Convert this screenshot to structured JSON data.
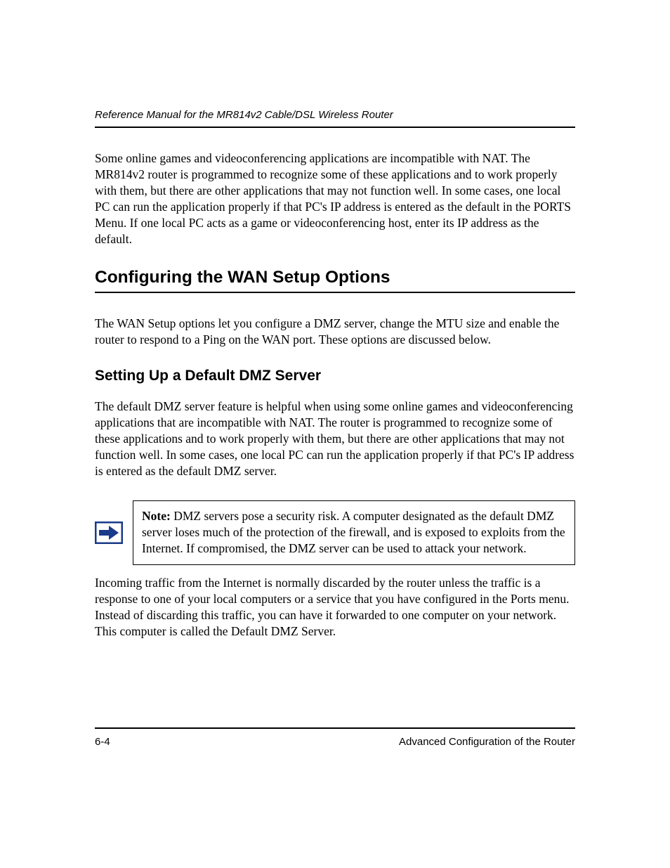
{
  "header": {
    "title": "Reference Manual for the MR814v2 Cable/DSL Wireless Router"
  },
  "content": {
    "para1": "Some online games and videoconferencing applications are incompatible with NAT. The MR814v2 router is programmed to recognize some of these applications and to work properly with them, but there are other applications that may not function well. In some cases, one local PC can run the application properly if that PC's IP address is entered as the default in the PORTS Menu. If one local PC acts as a game or videoconferencing host, enter its IP address as the default.",
    "h1": "Configuring the WAN Setup Options",
    "para2": "The WAN Setup options let you configure a DMZ server, change the MTU size and enable the router to respond to a Ping on the WAN port. These options are discussed below.",
    "h2": "Setting Up a Default DMZ Server",
    "para3": "The default DMZ server feature is helpful when using some online games and videoconferencing applications that are incompatible with NAT. The router is programmed to recognize some of these applications and to work properly with them, but there are other applications that may not function well. In some cases, one local PC can run the application properly if that PC's IP address is entered as the default DMZ server.",
    "note": {
      "label": "Note:",
      "text": " DMZ servers pose a security risk. A computer designated as the default DMZ server loses much of the protection of the firewall, and is exposed to exploits from the Internet. If compromised, the DMZ server can be used to attack your network."
    },
    "para4": "Incoming traffic from the Internet is normally discarded by the router unless the traffic is a response to one of your local computers or a service that you have configured in the Ports menu. Instead of discarding this traffic, you can have it forwarded to one computer on your network. This computer is called the Default DMZ Server."
  },
  "footer": {
    "page_number": "6-4",
    "section": "Advanced Configuration of the Router"
  },
  "icons": {
    "note_arrow": "arrow-right-icon"
  }
}
